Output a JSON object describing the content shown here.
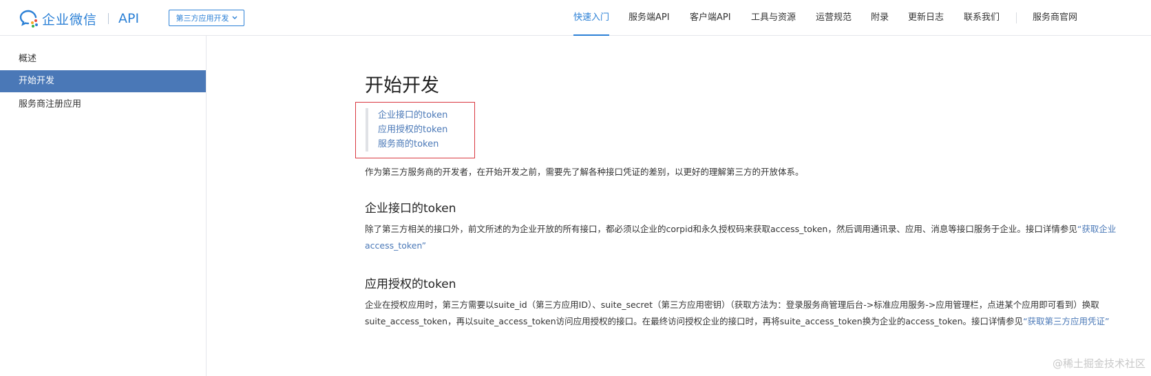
{
  "header": {
    "logo_text": "企业微信",
    "logo_api": "API",
    "dropdown_label": "第三方应用开发",
    "nav": [
      {
        "label": "快速入门",
        "active": true
      },
      {
        "label": "服务端API",
        "active": false
      },
      {
        "label": "客户端API",
        "active": false
      },
      {
        "label": "工具与资源",
        "active": false
      },
      {
        "label": "运营规范",
        "active": false
      },
      {
        "label": "附录",
        "active": false
      },
      {
        "label": "更新日志",
        "active": false
      },
      {
        "label": "联系我们",
        "active": false
      },
      {
        "label": "服务商官网",
        "active": false
      }
    ]
  },
  "sidebar": {
    "items": [
      {
        "label": "概述",
        "active": false
      },
      {
        "label": "开始开发",
        "active": true
      },
      {
        "label": "服务商注册应用",
        "active": false
      }
    ]
  },
  "main": {
    "title": "开始开发",
    "toc": [
      "企业接口的token",
      "应用授权的token",
      "服务商的token"
    ],
    "intro": "作为第三方服务商的开发者，在开始开发之前，需要先了解各种接口凭证的差别，以更好的理解第三方的开放体系。",
    "sections": [
      {
        "heading": "企业接口的token",
        "text": "除了第三方相关的接口外，前文所述的为企业开放的所有接口，都必须以企业的corpid和永久授权码来获取access_token，然后调用通讯录、应用、消息等接口服务于企业。接口详情参见",
        "link": "“获取企业access_token”"
      },
      {
        "heading": "应用授权的token",
        "text": "企业在授权应用时，第三方需要以suite_id（第三方应用ID）、suite_secret（第三方应用密钥）（获取方法为：登录服务商管理后台->标准应用服务->应用管理栏，点进某个应用即可看到）换取suite_access_token，再以suite_access_token访问应用授权的接口。在最终访问授权企业的接口时，再将suite_access_token换为企业的access_token。接口详情参见",
        "link": "“获取第三方应用凭证”"
      }
    ]
  },
  "watermark": "@稀土掘金技术社区",
  "colors": {
    "accent": "#2b80d6",
    "sidebar_active": "#4a78b7",
    "highlight_box": "#d9363e"
  }
}
